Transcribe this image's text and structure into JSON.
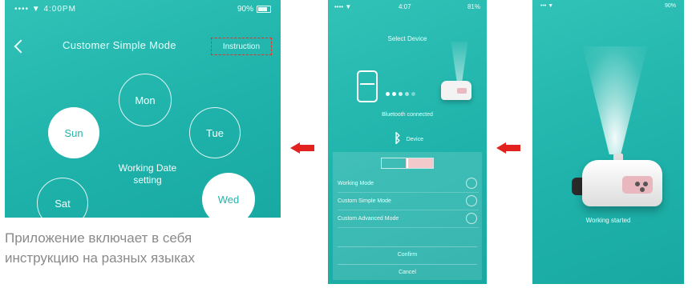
{
  "screen_a": {
    "status_left": "•••• ▼ 4:00PM",
    "status_right": "90%",
    "title": "Customer Simple Mode",
    "instruction_button": "Instruction",
    "modes": [
      "Mon",
      "Sun",
      "Tue",
      "Sat",
      "Wed"
    ],
    "center_text_line1": "Working Date",
    "center_text_line2": "setting"
  },
  "caption_line1": "Приложение включает в себя",
  "caption_line2": "инструкцию на разных языках",
  "screen_b": {
    "status_left": "•••• ▼",
    "status_center": "4:07",
    "status_right": "81%",
    "title": "Select Device",
    "connection_status": "Bluetooth connected",
    "bluetooth_label": "Device",
    "options": [
      "Working Mode",
      "Custom Simple Mode",
      "Custom Advanced Mode"
    ],
    "confirm_button": "Confirm",
    "cancel_button": "Cancel"
  },
  "screen_c": {
    "status_left": "••• ▼",
    "status_right": "90%",
    "label": "Working started"
  },
  "colors": {
    "teal": "#22b6ae",
    "arrow_red": "#e3211f",
    "highlight_dashed": "#e0342c"
  }
}
